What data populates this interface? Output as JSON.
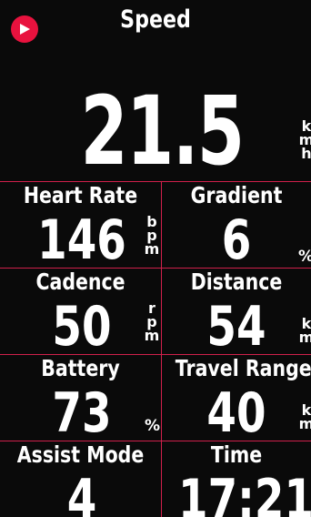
{
  "hero": {
    "label": "Speed",
    "value": "21.5",
    "unit": [
      "k",
      "m",
      "h"
    ]
  },
  "cells": [
    {
      "label": "Heart Rate",
      "value": "146",
      "unit": [
        "b",
        "p",
        "m"
      ]
    },
    {
      "label": "Gradient",
      "value": "6",
      "unit": "%"
    },
    {
      "label": "Cadence",
      "value": "50",
      "unit": [
        "r",
        "p",
        "m"
      ]
    },
    {
      "label": "Distance",
      "value": "54",
      "unit": [
        "k",
        "m"
      ]
    },
    {
      "label": "Battery",
      "value": "73",
      "unit": "%"
    },
    {
      "label": "Travel Range",
      "value": "40",
      "unit": [
        "k",
        "m"
      ]
    },
    {
      "label": "Assist Mode",
      "value": "4"
    },
    {
      "label": "Time",
      "value": "17:21"
    }
  ],
  "colors": {
    "accent": "#e8123e",
    "divider": "#d0204b",
    "background": "#0a0a0a",
    "text": "#ffffff"
  },
  "icons": {
    "play": "play-icon"
  }
}
